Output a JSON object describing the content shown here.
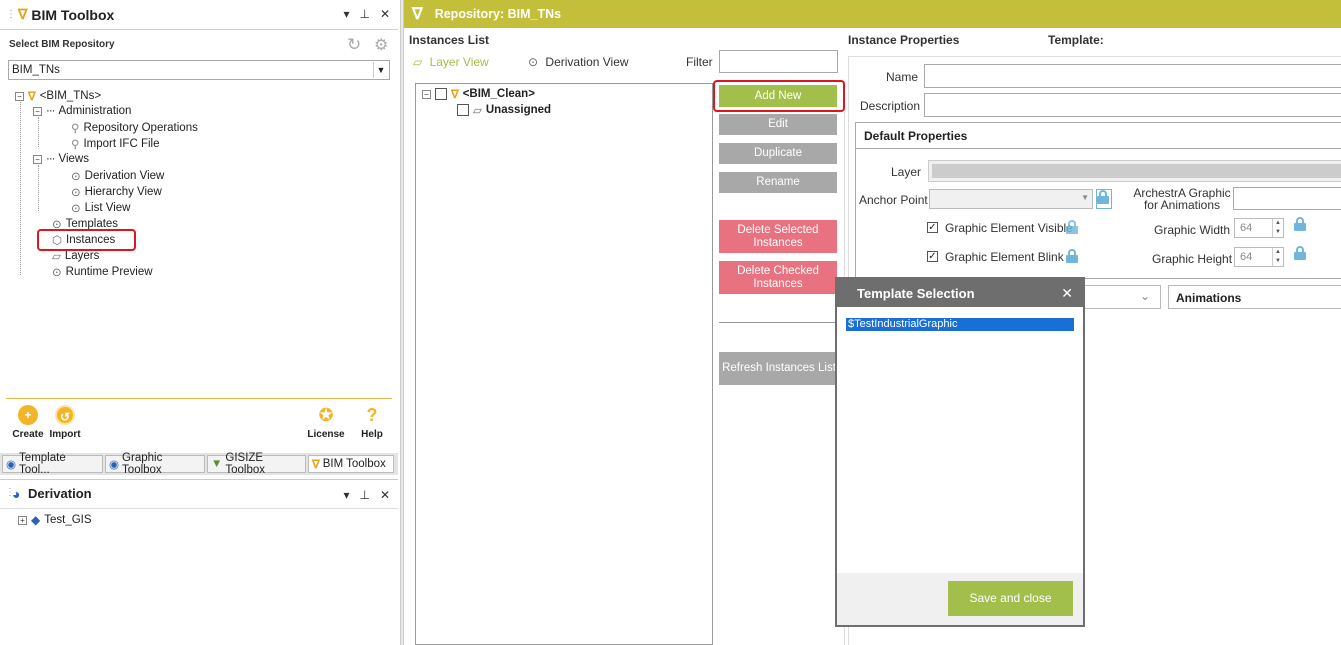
{
  "toolbox": {
    "title": "BIM Toolbox",
    "select_label": "Select BIM Repository",
    "repository_value": "BIM_TNs",
    "tree": {
      "root": "<BIM_TNs>",
      "administration": "Administration",
      "repository_operations": "Repository Operations",
      "import_ifc": "Import IFC File",
      "views": "Views",
      "derivation_view": "Derivation View",
      "hierarchy_view": "Hierarchy View",
      "list_view": "List View",
      "templates": "Templates",
      "instances": "Instances",
      "layers": "Layers",
      "runtime_preview": "Runtime Preview"
    },
    "actions": {
      "create": "Create",
      "import": "Import",
      "license": "License",
      "help": "Help"
    },
    "tabs": [
      "Template Tool...",
      "Graphic Toolbox",
      "GISIZE Toolbox",
      "BIM Toolbox"
    ]
  },
  "derivation": {
    "title": "Derivation",
    "item": "Test_GIS"
  },
  "repository": {
    "header": "Repository: BIM_TNs",
    "instances_list_label": "Instances List",
    "layer_view": "Layer View",
    "derivation_view": "Derivation View",
    "filter_label": "Filter",
    "tree_root": "<BIM_Clean>",
    "tree_child": "Unassigned",
    "buttons": {
      "add_new": "Add New",
      "edit": "Edit",
      "duplicate": "Duplicate",
      "rename": "Rename",
      "delete_selected": "Delete Selected Instances",
      "delete_checked": "Delete Checked Instances",
      "refresh": "Refresh Instances List"
    }
  },
  "properties": {
    "title": "Instance Properties",
    "template_label": "Template:",
    "name_label": "Name",
    "description_label": "Description",
    "default_properties": "Default Properties",
    "layer_label": "Layer",
    "anchor_label": "Anchor Point",
    "archestra_label": "ArchestrA Graphic for Animations",
    "visible_label": "Graphic Element Visible",
    "blink_label": "Graphic Element Blink",
    "width_label": "Graphic Width",
    "width_value": "64",
    "height_label": "Graphic Height",
    "height_value": "64",
    "animations_label": "Animations"
  },
  "dialog": {
    "title": "Template Selection",
    "selected_item": "$TestIndustrialGraphic",
    "save_button": "Save and close"
  },
  "colors": {
    "accent_olive": "#c4bf3a",
    "button_gray": "#a8a8a8",
    "button_pink": "#e8727f",
    "button_green": "#a3bf4b",
    "highlight_red": "#e0141e",
    "selection_blue": "#1a6fd4"
  }
}
